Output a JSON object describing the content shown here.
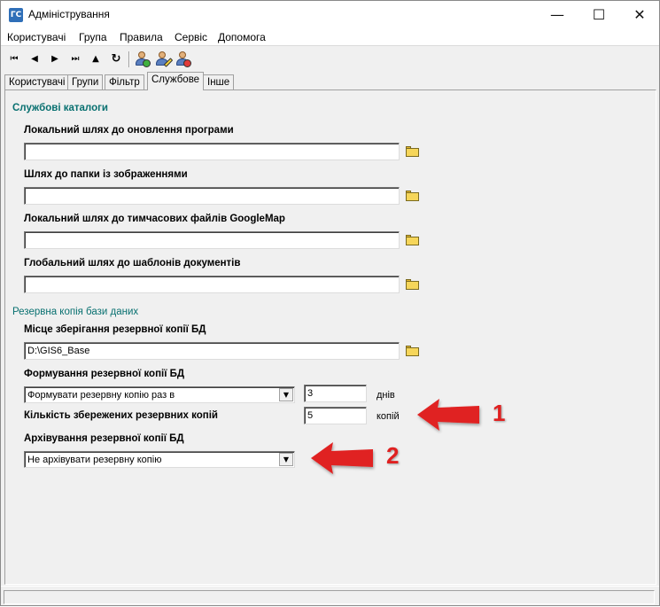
{
  "window": {
    "title": "Адміністрування",
    "icon": "app-icon",
    "controls": [
      "minimize-icon",
      "maximize-icon",
      "close-icon"
    ]
  },
  "menu": {
    "items": [
      "Користувачі",
      "Група",
      "Правила",
      "Сервіс",
      "Допомога"
    ]
  },
  "toolbar": {
    "buttons": [
      "first-record-icon",
      "prev-record-icon",
      "next-record-icon",
      "last-record-icon",
      "up-icon",
      "refresh-icon",
      "add-user-icon",
      "edit-user-icon",
      "delete-user-icon"
    ]
  },
  "tabs": {
    "items": [
      "Користувачі",
      "Групи",
      "Фільтр",
      "Службове",
      "Інше"
    ],
    "active": "Службове"
  },
  "service_catalogs": {
    "title": "Службові каталоги",
    "fields": [
      {
        "label": "Локальний шлях до оновлення програми",
        "value": ""
      },
      {
        "label": "Шлях до папки із зображеннями",
        "value": ""
      },
      {
        "label": "Локальний шлях до тимчасових файлів GoogleMap",
        "value": ""
      },
      {
        "label": "Глобальний шлях до шаблонів документів",
        "value": ""
      }
    ]
  },
  "backup": {
    "title": "Резервна копія бази даних",
    "location_label": "Місце зберігання резервної копії БД",
    "location_value": "D:\\GIS6_Base",
    "formation_label": "Формування резервної копії БД",
    "formation_value": "Формувати резервну копію раз в",
    "days_value": "3",
    "days_unit": "днів",
    "count_label": "Кількість збережених резервних копій",
    "count_value": "5",
    "count_unit": "копій",
    "archive_label": "Архівування резервної копії БД",
    "archive_value": "Не архівувати резервну копію"
  },
  "annotations": {
    "arrow1_label": "1",
    "arrow2_label": "2",
    "arrow_color": "#e02020"
  }
}
